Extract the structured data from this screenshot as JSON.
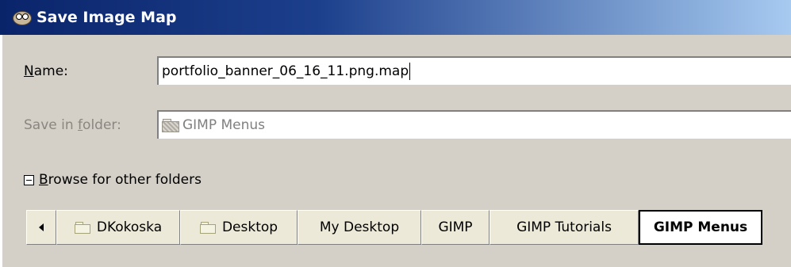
{
  "window": {
    "title": "Save Image Map",
    "icon": "gimp-wilber-icon"
  },
  "form": {
    "name_label_mnemonic": "N",
    "name_label_rest": "ame:",
    "name_value": "portfolio_banner_06_16_11.png.map",
    "folder_label_prefix": "Save in ",
    "folder_label_mnemonic": "f",
    "folder_label_rest": "older:",
    "folder_value": "GIMP Menus",
    "folder_icon": "folder-icon"
  },
  "browse": {
    "mnemonic": "B",
    "label_rest": "rowse for other folders",
    "expanded": true
  },
  "pathbar": {
    "back_icon": "left-arrow-icon",
    "items": [
      {
        "label": "DKokoska",
        "icon": "folder-icon"
      },
      {
        "label": "Desktop",
        "icon": "folder-icon"
      },
      {
        "label": "My Desktop"
      },
      {
        "label": "GIMP"
      },
      {
        "label": "GIMP Tutorials"
      },
      {
        "label": "GIMP Menus",
        "active": true
      }
    ]
  }
}
